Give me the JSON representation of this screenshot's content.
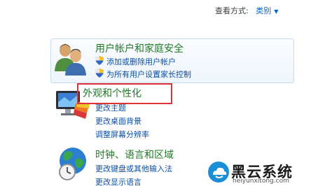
{
  "header": {
    "view_by_label": "查看方式:",
    "view_by_value": "类别"
  },
  "categories": [
    {
      "title": "用户帐户和家庭安全",
      "links": [
        "添加或删除用户帐户",
        "为所有用户设置家长控制"
      ]
    },
    {
      "title": "外观和个性化",
      "links": [
        "更改主题",
        "更改桌面背景",
        "调整屏幕分辨率"
      ]
    },
    {
      "title": "时钟、语言和区域",
      "links": [
        "更改键盘或其他输入法",
        "更改显示语言"
      ]
    }
  ],
  "watermark": {
    "name": "黑云系统",
    "url": "heiyunxitong.com"
  },
  "colors": {
    "link": "#0b4fa3",
    "category_title": "#1f7a26",
    "highlight_border": "#e0313a"
  }
}
